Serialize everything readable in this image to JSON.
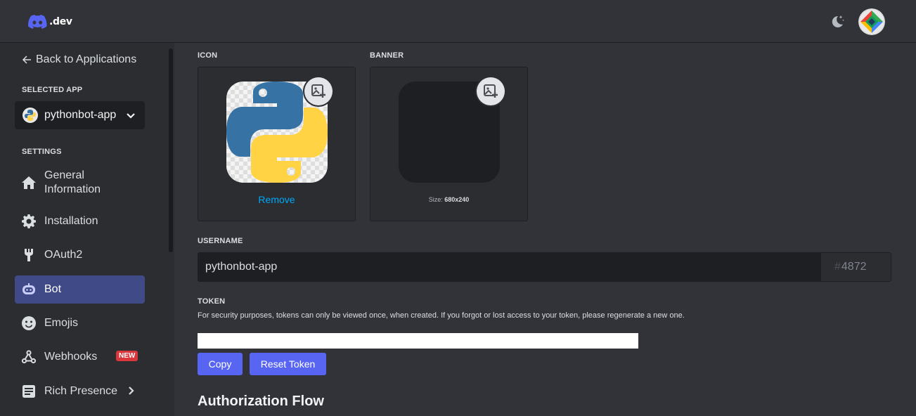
{
  "header": {
    "logo_text": ".dev",
    "icons": {
      "logo": "discord-logo-icon",
      "theme": "moon-stars-icon",
      "avatar": "user-avatar"
    }
  },
  "sidebar": {
    "back_label": "Back to Applications",
    "selected_app_label": "SELECTED APP",
    "selected_app_name": "pythonbot-app",
    "settings_label": "SETTINGS",
    "items": [
      {
        "label": "General Information",
        "icon": "home-icon",
        "active": false
      },
      {
        "label": "Installation",
        "icon": "gear-icon",
        "active": false
      },
      {
        "label": "OAuth2",
        "icon": "wrench-icon",
        "active": false
      },
      {
        "label": "Bot",
        "icon": "bot-icon",
        "active": true
      },
      {
        "label": "Emojis",
        "icon": "emoji-icon",
        "active": false
      },
      {
        "label": "Webhooks",
        "icon": "webhook-icon",
        "active": false,
        "badge": "NEW"
      },
      {
        "label": "Rich Presence",
        "icon": "rich-presence-icon",
        "active": false,
        "has_submenu": true
      }
    ]
  },
  "main": {
    "icon_label": "ICON",
    "banner_label": "BANNER",
    "remove_label": "Remove",
    "banner_size_prefix": "Size:",
    "banner_size": "680x240",
    "username_label": "USERNAME",
    "username_value": "pythonbot-app",
    "discriminator_hash": "#",
    "discriminator": "4872",
    "token_label": "TOKEN",
    "token_description": "For security purposes, tokens can only be viewed once, when created. If you forgot or lost access to your token, please regenerate a new one.",
    "copy_label": "Copy",
    "reset_token_label": "Reset Token",
    "auth_flow_title": "Authorization Flow"
  },
  "colors": {
    "background": "#313338",
    "sidebar": "#2b2d31",
    "blurple": "#5865f2",
    "active_nav": "#404a87",
    "link": "#00a8fc",
    "badge_red": "#da373c"
  }
}
